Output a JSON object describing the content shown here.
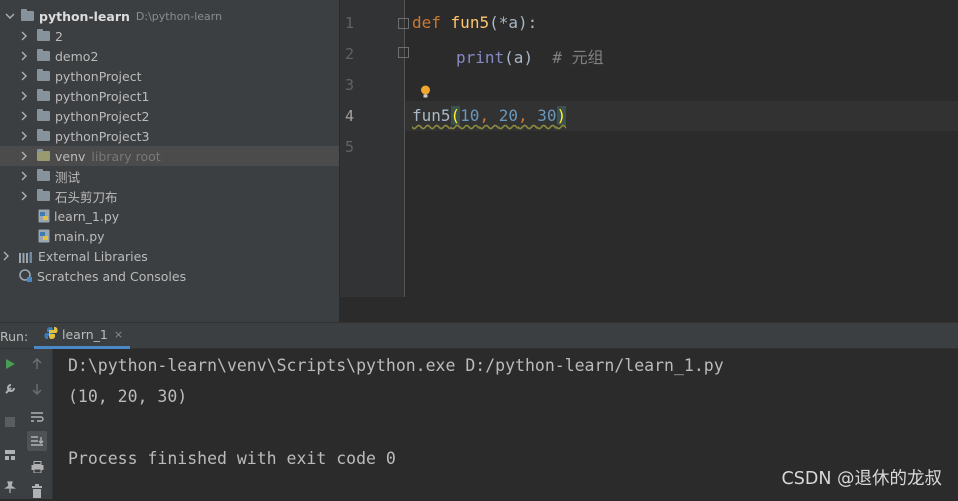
{
  "project": {
    "root": {
      "name": "python-learn",
      "path": "D:\\python-learn"
    },
    "items": [
      {
        "label": "2",
        "type": "folder"
      },
      {
        "label": "demo2",
        "type": "folder"
      },
      {
        "label": "pythonProject",
        "type": "folder"
      },
      {
        "label": "pythonProject1",
        "type": "folder"
      },
      {
        "label": "pythonProject2",
        "type": "folder"
      },
      {
        "label": "pythonProject3",
        "type": "folder"
      },
      {
        "label": "venv",
        "type": "folder",
        "hint": "library root"
      },
      {
        "label": "测试",
        "type": "folder"
      },
      {
        "label": "石头剪刀布",
        "type": "folder"
      },
      {
        "label": "learn_1.py",
        "type": "python-file"
      },
      {
        "label": "main.py",
        "type": "python-file"
      }
    ],
    "external_libraries": "External Libraries",
    "scratches": "Scratches and Consoles"
  },
  "editor": {
    "line_numbers": [
      "1",
      "2",
      "3",
      "4",
      "5"
    ],
    "active_line": "4",
    "line1": {
      "kw": "def",
      "fn": "fun5",
      "rest": "(*a):"
    },
    "line2": {
      "builtin": "print",
      "rest": "(a)  ",
      "comment": "# 元组"
    },
    "line4": {
      "fn": "fun5",
      "open": "(",
      "n1": "10",
      "sep1": ", ",
      "n2": "20",
      "sep2": ", ",
      "n3": "30",
      "close": ")"
    }
  },
  "run": {
    "label": "Run:",
    "tab": "learn_1",
    "tab_close": "×",
    "console": [
      "D:\\python-learn\\venv\\Scripts\\python.exe D:/python-learn/learn_1.py",
      "(10, 20, 30)",
      "",
      "Process finished with exit code 0"
    ]
  },
  "watermark": "CSDN @退休的龙叔",
  "colors": {
    "keyword": "#cc7832",
    "function": "#ffc66d",
    "number": "#6897bb",
    "builtin": "#8888c6",
    "comment": "#808080",
    "tab_underline": "#4a88c7",
    "run_green": "#499c54"
  }
}
